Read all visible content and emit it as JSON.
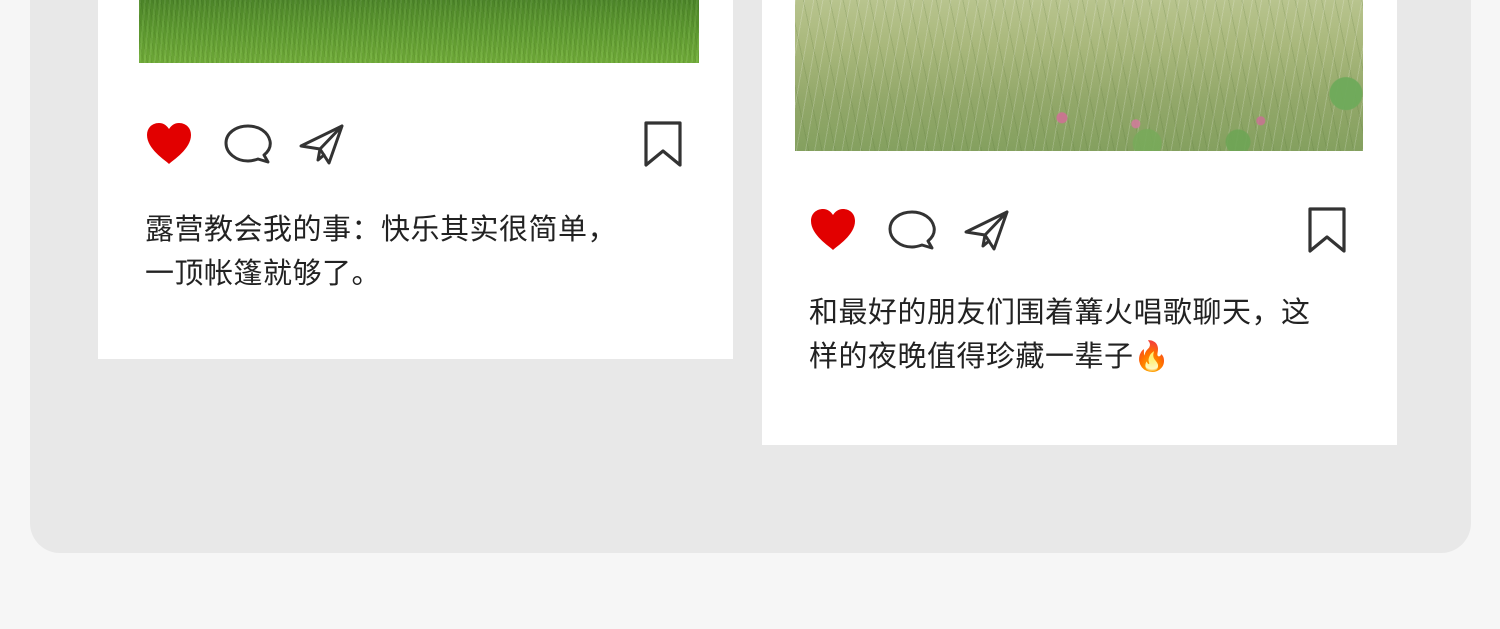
{
  "colors": {
    "page_background": "#f6f6f6",
    "panel_background": "#e8e8e8",
    "card_background": "#ffffff",
    "like_active": "#e20000",
    "icon_stroke": "#333333",
    "caption_text": "#222222"
  },
  "posts": [
    {
      "photo": "green-grass-field-photo",
      "liked": true,
      "icons": [
        "heart-icon",
        "comment-icon",
        "share-icon",
        "bookmark-icon"
      ],
      "caption_line1": "露营教会我的事：快乐其实很简单，",
      "caption_line2": "一顶帐篷就够了。"
    },
    {
      "photo": "wild-grass-and-flowers-photo",
      "liked": true,
      "icons": [
        "heart-icon",
        "comment-icon",
        "share-icon",
        "bookmark-icon"
      ],
      "caption_line1": "和最好的朋友们围着篝火唱歌聊天，这",
      "caption_line2": "样的夜晚值得珍藏一辈子🔥"
    }
  ]
}
